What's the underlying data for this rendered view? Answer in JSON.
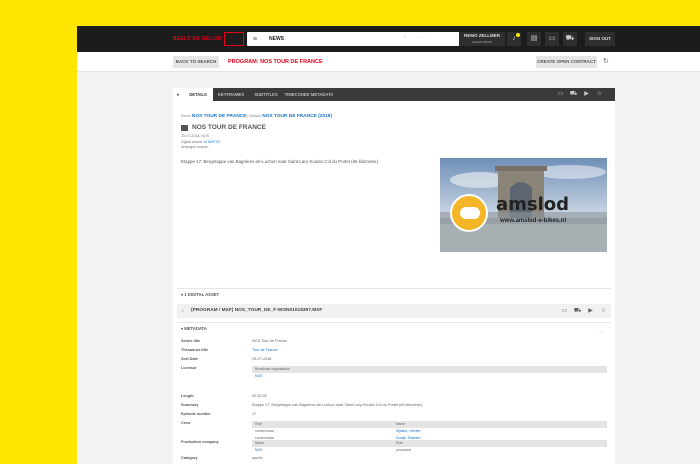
{
  "topbar": {
    "logo_text": "BEELD EN GELUID",
    "search_value": "NEWS",
    "user_name": "REMO ZELLMER",
    "user_role": "SALES ADMIN",
    "notification_count": "1",
    "signout_label": "SIGN OUT"
  },
  "subbar": {
    "back_label": "BACK TO SEARCH",
    "program_title": "PROGRAM: NOS TOUR DE FRANCE",
    "contract_label": "CREATE OPEN CONTRACT"
  },
  "tabs": [
    "DETAILS",
    "KEYFRAMES",
    "SUBTITLES",
    "TIMECODED METADATA"
  ],
  "details": {
    "series_prefix": "Series",
    "series_link": "NOS TOUR DE FRANCE",
    "season_prefix": "Season",
    "season_link": "NOS TOUR DE FRANCE (2018)",
    "title": "NOS TOUR DE FRANCE",
    "date_line": "25-07-2018, NOS",
    "digital_label": "Digital assets",
    "digital_value": "1x MXF22",
    "analogue_label": "Analogue assets",
    "analogue_value": "-",
    "description": "Etappe 17: Bergetappe van Bagnères-de-Luchon naar Saint-Lary-Soulan Col du Portet (65 kilometer).",
    "thumb_brand": "amslod",
    "thumb_url": "www.amslod-e-bikes.nl"
  },
  "digital_section": "1 DIGITAL ASSET",
  "digital_asset_name": "(PROGRAM / MXF) NOS_TOUR_DE_F-WON01018397.MXF",
  "metadata_section": "METADATA",
  "metadata": {
    "series_title_label": "Series title",
    "series_title": "NOS Tour de France",
    "thesaurus_label": "Thesaurus title",
    "thesaurus": "Tour de France",
    "sort_date_label": "Sort Date",
    "sort_date": "25-07-2018",
    "licensor_label": "Licensor",
    "licensor_head": "Broadcast organisation",
    "licensor_val": "NOS",
    "length_label": "Length",
    "length": "02:30:05",
    "summary_label": "Summary",
    "summary": "Etappe 17: Bergetappe van Bagnères-de-Luchon naar Saint-Lary-Soulan Col du Portet (65 kilometer).",
    "episode_label": "Episode number",
    "episode": "17",
    "crew_label": "Crew",
    "crew_head_role": "Role",
    "crew_head_name": "Name",
    "crew": [
      {
        "role": "commentaar",
        "name": "Dijkstra, Herbert"
      },
      {
        "role": "commentaar",
        "name": "Duwijn, Maarten"
      }
    ],
    "category_label": "Category",
    "category": "sports",
    "production_label": "Production company",
    "prod_head_name": "Name",
    "prod_head_role": "Role",
    "prod_name": "NOS",
    "prod_role": "producent"
  },
  "colors": {
    "accent": "#e2001a",
    "brand_yellow": "#FFE600",
    "link": "#1a73c6"
  }
}
